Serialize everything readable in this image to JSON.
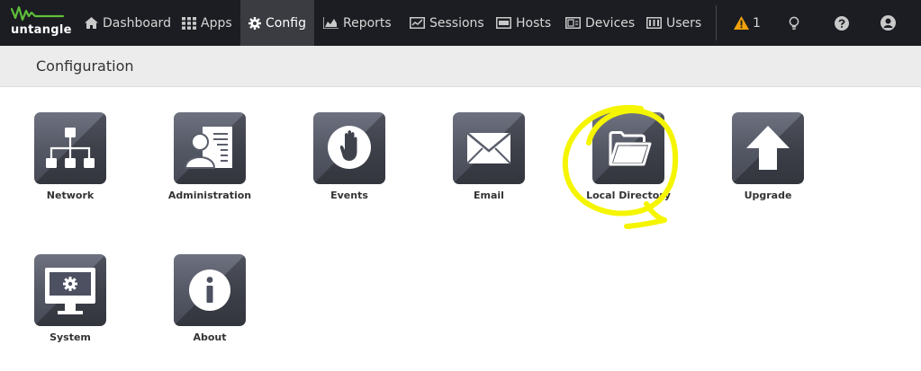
{
  "brand": {
    "logo_text": "untangle",
    "logo_icon": "untangle-wave-icon"
  },
  "nav": {
    "items": [
      {
        "label": "Dashboard",
        "icon": "home-icon"
      },
      {
        "label": "Apps",
        "icon": "grid-icon"
      },
      {
        "label": "Config",
        "icon": "gear-icon",
        "active": true
      },
      {
        "label": "Reports",
        "icon": "area-chart-icon"
      },
      {
        "label": "Sessions",
        "icon": "sessions-icon"
      },
      {
        "label": "Hosts",
        "icon": "hosts-icon"
      },
      {
        "label": "Devices",
        "icon": "devices-icon"
      },
      {
        "label": "Users",
        "icon": "users-icon"
      }
    ],
    "alerts": {
      "count": "1",
      "icon": "warning-icon",
      "color": "#f0a30a"
    },
    "right_icons": [
      "lightbulb-icon",
      "help-icon",
      "account-icon"
    ]
  },
  "page": {
    "title": "Configuration"
  },
  "tiles": [
    {
      "label": "Network",
      "icon": "network-icon"
    },
    {
      "label": "Administration",
      "icon": "administration-icon"
    },
    {
      "label": "Events",
      "icon": "events-hand-icon"
    },
    {
      "label": "Email",
      "icon": "email-icon"
    },
    {
      "label": "Local Directory",
      "icon": "folder-icon",
      "highlighted": true
    },
    {
      "label": "Upgrade",
      "icon": "upgrade-arrow-icon"
    },
    {
      "label": "System",
      "icon": "system-monitor-icon"
    },
    {
      "label": "About",
      "icon": "info-icon"
    }
  ],
  "colors": {
    "topbar": "#1b1d22",
    "active_tab": "#3a3c41",
    "logo_green": "#5fbf3a",
    "tile": "#5a5e6b",
    "annotation": "#f5f500"
  }
}
